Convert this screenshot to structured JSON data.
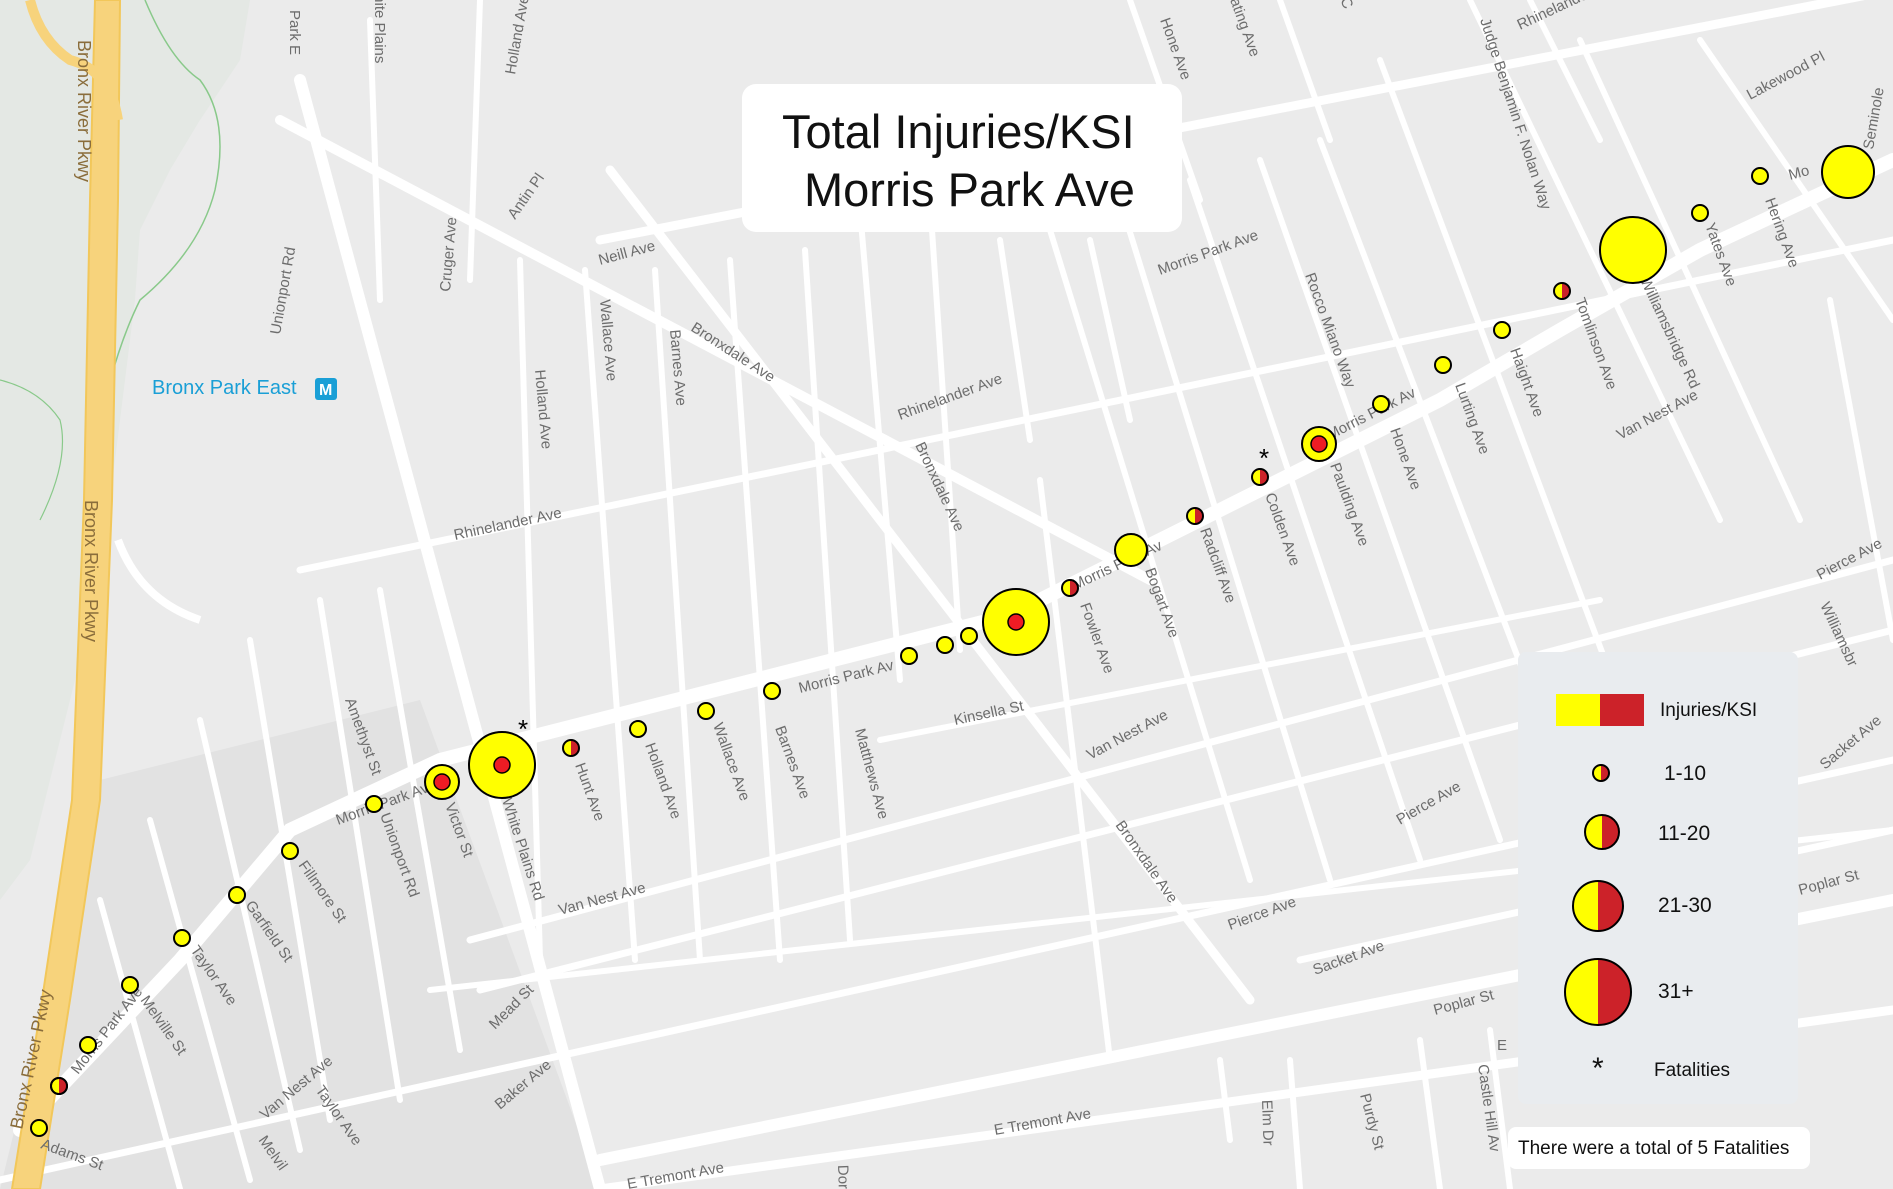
{
  "title": {
    "line1": "Total Injuries/KSI",
    "line2": "Morris Park Ave"
  },
  "colors": {
    "injuries": "#ffff00",
    "ksi": "#cc2229",
    "road": "#ffffff",
    "background": "#ebebeb",
    "highway": "#f7d37c"
  },
  "map_labels": {
    "bronx_river_pkwy_1": "Bronx River Pkwy",
    "bronx_river_pkwy_2": "Bronx River Pkwy",
    "bronx_river_pkwy_3": "Bronx River Pkwy",
    "bronx_park_east": "Bronx Park East",
    "bronx_park_east_icon": "subway-station-icon",
    "park_e": "Park E",
    "white_plains_top": "White Plains",
    "hone_ave_top": "Hone Ave",
    "eastchester_top": "ating Ave",
    "judge_nolan": "Judge Benjamin F. Nolan Way",
    "rhinelander_top_right": "Rhinelander",
    "lakewood_pl": "Lakewood Pl",
    "seminole": "Seminole",
    "morris_park_top_right": "Mo",
    "yates_ave": "Yates Ave",
    "hering_ave": "Hering Ave",
    "williamsbridge_rd": "Williamsbridge Rd",
    "tomlinson_ave": "Tomlinson Ave",
    "haight_ave": "Haight Ave",
    "lurting_ave": "Lurting Ave",
    "van_nest_ave_ne": "Van Nest Ave",
    "pierce_ave_ne": "Pierce Ave",
    "williamsbr_east": "Williamsbr",
    "sacket_ave_e": "Sacket Ave",
    "poplar_st_e": "Poplar St",
    "holland_ave_top": "Holland Ave",
    "antin_pl": "Antin Pl",
    "neill_ave": "Neill Ave",
    "unionport_rd_top": "Unionport Rd",
    "cruger_ave": "Cruger Ave",
    "holland_ave_mid": "Holland Ave",
    "wallace_ave_top": "Wallace Ave",
    "barnes_ave_top": "Barnes Ave",
    "bronxdale_ave_1": "Bronxdale Ave",
    "rhinelander_ave_mid": "Rhinelander Ave",
    "rocco_miano_way": "Rocco Miano Way",
    "hone_ave_mid": "Hone Ave",
    "paulding_ave": "Paulding Ave",
    "colden_ave": "Colden Ave",
    "radcliff_ave": "Radcliff Ave",
    "bogart_ave": "Bogart Ave",
    "fowler_ave": "Fowler Ave",
    "bronxdale_ave_2": "Bronxdale Ave",
    "rhinelander_ave_w": "Rhinelander Ave",
    "kinsella_st": "Kinsella St",
    "van_nest_ave_mid": "Van Nest Ave",
    "matthews_ave": "Matthews Ave",
    "barnes_ave": "Barnes Ave",
    "wallace_ave": "Wallace Ave",
    "holland_ave": "Holland Ave",
    "hunt_ave": "Hunt Ave",
    "white_plains_rd": "White Plains Rd",
    "victor_st": "Victor St",
    "unionport_rd": "Unionport Rd",
    "amethyst_st": "Amethyst St",
    "fillmore_st": "Fillmore St",
    "garfield_st": "Garfield St",
    "taylor_ave": "Taylor Ave",
    "melville_st": "Melville St",
    "adams_st": "Adams St",
    "van_nest_ave_sw": "Van Nest Ave",
    "van_nest_ave_s": "Van Nest Ave",
    "taylor_ave_s": "Taylor Ave",
    "melville_s": "Melvil",
    "mead_st": "Mead St",
    "baker_ave": "Baker Ave",
    "bronxdale_ave_3": "Bronxdale Ave",
    "pierce_ave_s": "Pierce Ave",
    "pierce_ave_se": "Pierce Ave",
    "sacket_ave_s": "Sacket Ave",
    "poplar_st_s": "Poplar St",
    "e_tremont_ave": "E Tremont Ave",
    "e_tremont_ave_2": "E Tremont Ave",
    "elm_dr": "Elm Dr",
    "purdy_st": "Purdy St",
    "castle_hill": "Castle Hill Av",
    "dor": "Dor",
    "e_label": "E",
    "morris_park_ave_1": "Morris Park Ave",
    "morris_park_ave_2": "Morris Park Av",
    "morris_park_ave_3": "Morris Park Av",
    "morris_park_ave_4": "Morris Park Av",
    "morris_park_ave_5": "Morris Park Ave",
    "morris_park_ave_6": "Morris Park Ave",
    "c_top": "C"
  },
  "legend": {
    "header": "Injuries/KSI",
    "rows": [
      {
        "label": "1-10"
      },
      {
        "label": "11-20"
      },
      {
        "label": "21-30"
      },
      {
        "label": "31+"
      }
    ],
    "fatalities_symbol": "*",
    "fatalities_label": "Fatalities"
  },
  "note": {
    "prefix": "There were a total of",
    "count": "5",
    "suffix": "Fatalities"
  },
  "chart_data": {
    "type": "map",
    "title": "Total Injuries/KSI Morris Park Ave",
    "categories_legend": [
      "1-10",
      "11-20",
      "21-30",
      "31+"
    ],
    "fatality_marker": "*",
    "total_fatalities": 5
  }
}
